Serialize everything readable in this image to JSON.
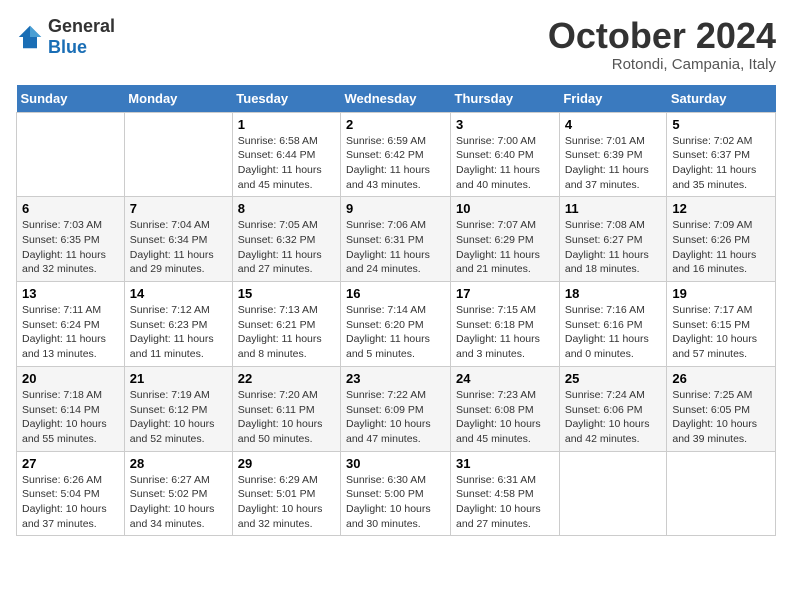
{
  "logo": {
    "general": "General",
    "blue": "Blue"
  },
  "header": {
    "month": "October 2024",
    "location": "Rotondi, Campania, Italy"
  },
  "weekdays": [
    "Sunday",
    "Monday",
    "Tuesday",
    "Wednesday",
    "Thursday",
    "Friday",
    "Saturday"
  ],
  "weeks": [
    [
      {
        "day": "",
        "info": ""
      },
      {
        "day": "",
        "info": ""
      },
      {
        "day": "1",
        "info": "Sunrise: 6:58 AM\nSunset: 6:44 PM\nDaylight: 11 hours and 45 minutes."
      },
      {
        "day": "2",
        "info": "Sunrise: 6:59 AM\nSunset: 6:42 PM\nDaylight: 11 hours and 43 minutes."
      },
      {
        "day": "3",
        "info": "Sunrise: 7:00 AM\nSunset: 6:40 PM\nDaylight: 11 hours and 40 minutes."
      },
      {
        "day": "4",
        "info": "Sunrise: 7:01 AM\nSunset: 6:39 PM\nDaylight: 11 hours and 37 minutes."
      },
      {
        "day": "5",
        "info": "Sunrise: 7:02 AM\nSunset: 6:37 PM\nDaylight: 11 hours and 35 minutes."
      }
    ],
    [
      {
        "day": "6",
        "info": "Sunrise: 7:03 AM\nSunset: 6:35 PM\nDaylight: 11 hours and 32 minutes."
      },
      {
        "day": "7",
        "info": "Sunrise: 7:04 AM\nSunset: 6:34 PM\nDaylight: 11 hours and 29 minutes."
      },
      {
        "day": "8",
        "info": "Sunrise: 7:05 AM\nSunset: 6:32 PM\nDaylight: 11 hours and 27 minutes."
      },
      {
        "day": "9",
        "info": "Sunrise: 7:06 AM\nSunset: 6:31 PM\nDaylight: 11 hours and 24 minutes."
      },
      {
        "day": "10",
        "info": "Sunrise: 7:07 AM\nSunset: 6:29 PM\nDaylight: 11 hours and 21 minutes."
      },
      {
        "day": "11",
        "info": "Sunrise: 7:08 AM\nSunset: 6:27 PM\nDaylight: 11 hours and 18 minutes."
      },
      {
        "day": "12",
        "info": "Sunrise: 7:09 AM\nSunset: 6:26 PM\nDaylight: 11 hours and 16 minutes."
      }
    ],
    [
      {
        "day": "13",
        "info": "Sunrise: 7:11 AM\nSunset: 6:24 PM\nDaylight: 11 hours and 13 minutes."
      },
      {
        "day": "14",
        "info": "Sunrise: 7:12 AM\nSunset: 6:23 PM\nDaylight: 11 hours and 11 minutes."
      },
      {
        "day": "15",
        "info": "Sunrise: 7:13 AM\nSunset: 6:21 PM\nDaylight: 11 hours and 8 minutes."
      },
      {
        "day": "16",
        "info": "Sunrise: 7:14 AM\nSunset: 6:20 PM\nDaylight: 11 hours and 5 minutes."
      },
      {
        "day": "17",
        "info": "Sunrise: 7:15 AM\nSunset: 6:18 PM\nDaylight: 11 hours and 3 minutes."
      },
      {
        "day": "18",
        "info": "Sunrise: 7:16 AM\nSunset: 6:16 PM\nDaylight: 11 hours and 0 minutes."
      },
      {
        "day": "19",
        "info": "Sunrise: 7:17 AM\nSunset: 6:15 PM\nDaylight: 10 hours and 57 minutes."
      }
    ],
    [
      {
        "day": "20",
        "info": "Sunrise: 7:18 AM\nSunset: 6:14 PM\nDaylight: 10 hours and 55 minutes."
      },
      {
        "day": "21",
        "info": "Sunrise: 7:19 AM\nSunset: 6:12 PM\nDaylight: 10 hours and 52 minutes."
      },
      {
        "day": "22",
        "info": "Sunrise: 7:20 AM\nSunset: 6:11 PM\nDaylight: 10 hours and 50 minutes."
      },
      {
        "day": "23",
        "info": "Sunrise: 7:22 AM\nSunset: 6:09 PM\nDaylight: 10 hours and 47 minutes."
      },
      {
        "day": "24",
        "info": "Sunrise: 7:23 AM\nSunset: 6:08 PM\nDaylight: 10 hours and 45 minutes."
      },
      {
        "day": "25",
        "info": "Sunrise: 7:24 AM\nSunset: 6:06 PM\nDaylight: 10 hours and 42 minutes."
      },
      {
        "day": "26",
        "info": "Sunrise: 7:25 AM\nSunset: 6:05 PM\nDaylight: 10 hours and 39 minutes."
      }
    ],
    [
      {
        "day": "27",
        "info": "Sunrise: 6:26 AM\nSunset: 5:04 PM\nDaylight: 10 hours and 37 minutes."
      },
      {
        "day": "28",
        "info": "Sunrise: 6:27 AM\nSunset: 5:02 PM\nDaylight: 10 hours and 34 minutes."
      },
      {
        "day": "29",
        "info": "Sunrise: 6:29 AM\nSunset: 5:01 PM\nDaylight: 10 hours and 32 minutes."
      },
      {
        "day": "30",
        "info": "Sunrise: 6:30 AM\nSunset: 5:00 PM\nDaylight: 10 hours and 30 minutes."
      },
      {
        "day": "31",
        "info": "Sunrise: 6:31 AM\nSunset: 4:58 PM\nDaylight: 10 hours and 27 minutes."
      },
      {
        "day": "",
        "info": ""
      },
      {
        "day": "",
        "info": ""
      }
    ]
  ]
}
